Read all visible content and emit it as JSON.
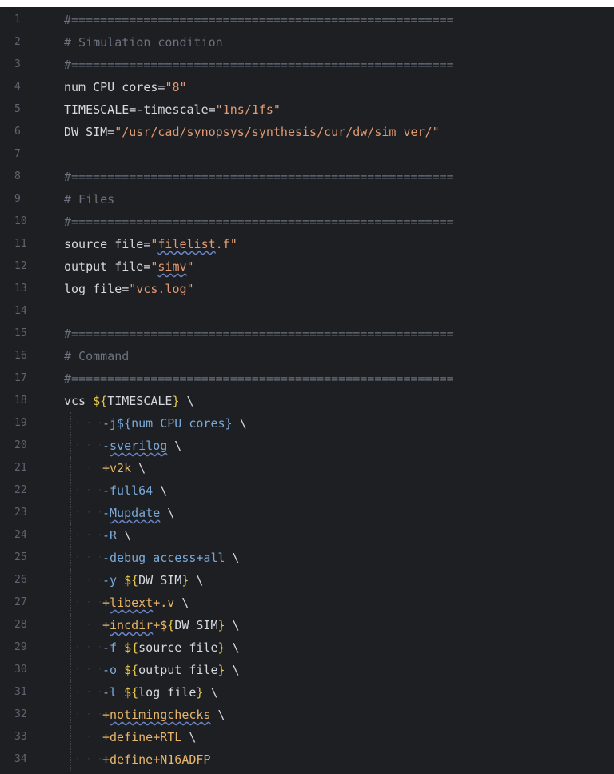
{
  "editor": {
    "lines": [
      {
        "n": "1",
        "segs": [
          {
            "t": "#=====================================================",
            "c": "comment"
          }
        ]
      },
      {
        "n": "2",
        "segs": [
          {
            "t": "# Simulation condition",
            "c": "comment"
          }
        ]
      },
      {
        "n": "3",
        "segs": [
          {
            "t": "#=====================================================",
            "c": "comment"
          }
        ]
      },
      {
        "n": "4",
        "segs": [
          {
            "t": "num CPU cores=",
            "c": "plain"
          },
          {
            "t": "\"8\"",
            "c": "str"
          }
        ]
      },
      {
        "n": "5",
        "segs": [
          {
            "t": "TIMESCALE=-timescale=",
            "c": "plain"
          },
          {
            "t": "\"1ns/1fs\"",
            "c": "str"
          }
        ]
      },
      {
        "n": "6",
        "segs": [
          {
            "t": "DW SIM=",
            "c": "plain"
          },
          {
            "t": "\"/usr/cad/synopsys/synthesis/cur/dw/sim ver/\"",
            "c": "str"
          }
        ]
      },
      {
        "n": "7",
        "segs": []
      },
      {
        "n": "8",
        "segs": [
          {
            "t": "#=====================================================",
            "c": "comment"
          }
        ]
      },
      {
        "n": "9",
        "segs": [
          {
            "t": "# Files",
            "c": "comment"
          }
        ]
      },
      {
        "n": "10",
        "segs": [
          {
            "t": "#=====================================================",
            "c": "comment"
          }
        ]
      },
      {
        "n": "11",
        "segs": [
          {
            "t": "source file=",
            "c": "plain"
          },
          {
            "t": "\"",
            "c": "str"
          },
          {
            "t": "filelist",
            "c": "str",
            "sq": true
          },
          {
            "t": ".f\"",
            "c": "str"
          }
        ]
      },
      {
        "n": "12",
        "segs": [
          {
            "t": "output file=",
            "c": "plain"
          },
          {
            "t": "\"",
            "c": "str"
          },
          {
            "t": "simv",
            "c": "str",
            "sq": true
          },
          {
            "t": "\"",
            "c": "str"
          }
        ]
      },
      {
        "n": "13",
        "segs": [
          {
            "t": "log file=",
            "c": "plain"
          },
          {
            "t": "\"vcs.log\"",
            "c": "str"
          }
        ]
      },
      {
        "n": "14",
        "segs": []
      },
      {
        "n": "15",
        "segs": [
          {
            "t": "#=====================================================",
            "c": "comment"
          }
        ]
      },
      {
        "n": "16",
        "segs": [
          {
            "t": "# Command",
            "c": "comment"
          }
        ]
      },
      {
        "n": "17",
        "segs": [
          {
            "t": "#=====================================================",
            "c": "comment"
          }
        ]
      },
      {
        "n": "18",
        "segs": [
          {
            "t": "vcs ",
            "c": "plain"
          },
          {
            "t": "${",
            "c": "brace"
          },
          {
            "t": "TIMESCALE",
            "c": "plain"
          },
          {
            "t": "}",
            "c": "brace"
          },
          {
            "t": " \\",
            "c": "plain"
          }
        ]
      },
      {
        "n": "19",
        "indent": true,
        "segs": [
          {
            "t": "-j${num CPU cores}",
            "c": "opt"
          },
          {
            "t": " \\",
            "c": "plain"
          }
        ]
      },
      {
        "n": "20",
        "indent": true,
        "segs": [
          {
            "t": "-",
            "c": "opt"
          },
          {
            "t": "sverilog",
            "c": "opt",
            "sq": true
          },
          {
            "t": " \\",
            "c": "plain"
          }
        ]
      },
      {
        "n": "21",
        "indent": true,
        "segs": [
          {
            "t": "+v2k",
            "c": "plus"
          },
          {
            "t": " \\",
            "c": "plain"
          }
        ]
      },
      {
        "n": "22",
        "indent": true,
        "segs": [
          {
            "t": "-full64",
            "c": "opt"
          },
          {
            "t": " \\",
            "c": "plain"
          }
        ]
      },
      {
        "n": "23",
        "indent": true,
        "segs": [
          {
            "t": "-",
            "c": "opt"
          },
          {
            "t": "Mupdate",
            "c": "opt",
            "sq": true
          },
          {
            "t": " \\",
            "c": "plain"
          }
        ]
      },
      {
        "n": "24",
        "indent": true,
        "segs": [
          {
            "t": "-R",
            "c": "opt"
          },
          {
            "t": " \\",
            "c": "plain"
          }
        ]
      },
      {
        "n": "25",
        "indent": true,
        "segs": [
          {
            "t": "-debug access+all",
            "c": "opt"
          },
          {
            "t": " \\",
            "c": "plain"
          }
        ]
      },
      {
        "n": "26",
        "indent": true,
        "segs": [
          {
            "t": "-y ",
            "c": "opt"
          },
          {
            "t": "${",
            "c": "brace"
          },
          {
            "t": "DW SIM",
            "c": "plain"
          },
          {
            "t": "}",
            "c": "brace"
          },
          {
            "t": " \\",
            "c": "plain"
          }
        ]
      },
      {
        "n": "27",
        "indent": true,
        "segs": [
          {
            "t": "+",
            "c": "plus"
          },
          {
            "t": "libext",
            "c": "plus",
            "sq": true
          },
          {
            "t": "+.v",
            "c": "plus"
          },
          {
            "t": " \\",
            "c": "plain"
          }
        ]
      },
      {
        "n": "28",
        "indent": true,
        "segs": [
          {
            "t": "+",
            "c": "plus"
          },
          {
            "t": "incdir",
            "c": "plus",
            "sq": true
          },
          {
            "t": "+$",
            "c": "plus"
          },
          {
            "t": "{",
            "c": "brace"
          },
          {
            "t": "DW SIM",
            "c": "plain"
          },
          {
            "t": "}",
            "c": "brace"
          },
          {
            "t": " \\",
            "c": "plain"
          }
        ]
      },
      {
        "n": "29",
        "indent": true,
        "segs": [
          {
            "t": "-f ",
            "c": "opt"
          },
          {
            "t": "${",
            "c": "brace"
          },
          {
            "t": "source file",
            "c": "plain"
          },
          {
            "t": "}",
            "c": "brace"
          },
          {
            "t": " \\",
            "c": "plain"
          }
        ]
      },
      {
        "n": "30",
        "indent": true,
        "segs": [
          {
            "t": "-o ",
            "c": "opt"
          },
          {
            "t": "${",
            "c": "brace"
          },
          {
            "t": "output file",
            "c": "plain"
          },
          {
            "t": "}",
            "c": "brace"
          },
          {
            "t": " \\",
            "c": "plain"
          }
        ]
      },
      {
        "n": "31",
        "indent": true,
        "segs": [
          {
            "t": "-l ",
            "c": "opt"
          },
          {
            "t": "${",
            "c": "brace"
          },
          {
            "t": "log file",
            "c": "plain"
          },
          {
            "t": "}",
            "c": "brace"
          },
          {
            "t": " \\",
            "c": "plain"
          }
        ]
      },
      {
        "n": "32",
        "indent": true,
        "segs": [
          {
            "t": "+",
            "c": "plus"
          },
          {
            "t": "notimingchecks",
            "c": "plus",
            "sq": true
          },
          {
            "t": " \\",
            "c": "plain"
          }
        ]
      },
      {
        "n": "33",
        "indent": true,
        "segs": [
          {
            "t": "+define+RTL",
            "c": "plus"
          },
          {
            "t": " \\",
            "c": "plain"
          }
        ]
      },
      {
        "n": "34",
        "indent": true,
        "segs": [
          {
            "t": "+define+N16ADFP",
            "c": "plus"
          }
        ]
      }
    ]
  }
}
